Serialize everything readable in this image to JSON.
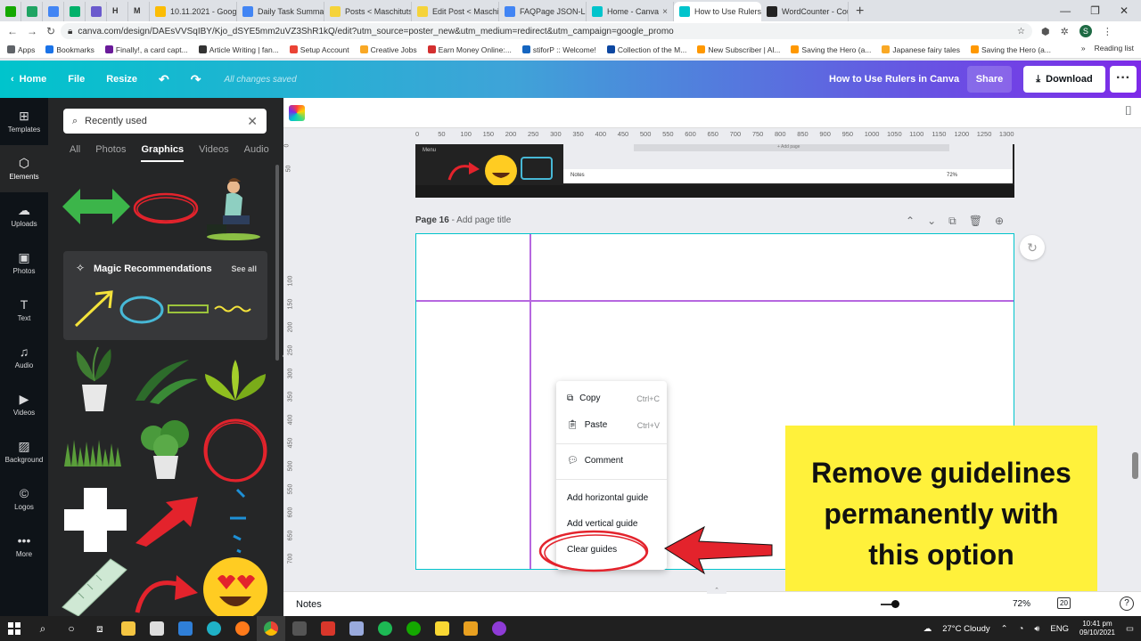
{
  "browser": {
    "tabs": [
      {
        "label": "",
        "color": "#14a800"
      },
      {
        "label": "",
        "color": "#1fa463"
      },
      {
        "label": "",
        "color": "#4285f4"
      },
      {
        "label": "",
        "color": "#00b16a"
      },
      {
        "label": "",
        "color": "#6a5acd"
      },
      {
        "label": "H",
        "color": "#ffffff"
      },
      {
        "label": "M",
        "color": "#ea4335"
      },
      {
        "label": "10.11.2021 - Googl...",
        "color": "#fbbc04"
      },
      {
        "label": "Daily Task Summary",
        "color": "#4285f4"
      },
      {
        "label": "Posts < Maschituts ...",
        "color": "#f5d33a"
      },
      {
        "label": "Edit Post < Maschitu...",
        "color": "#f5d33a"
      },
      {
        "label": "FAQPage JSON-LD S...",
        "color": "#4285f4"
      },
      {
        "label": "Home - Canva",
        "color": "#00c4cc"
      },
      {
        "label": "How to Use Rulers in...",
        "color": "#00c4cc"
      },
      {
        "label": "WordCounter - Cou...",
        "color": "#222222"
      }
    ],
    "active_tab_index": 13,
    "new_tab": "+",
    "url": "canva.com/design/DAEsVVSqIBY/Kjo_dSYE5mm2uVZ3ShR1kQ/edit?utm_source=poster_new&utm_medium=redirect&utm_campaign=google_promo",
    "profile_initial": "S",
    "bookmarks": [
      {
        "label": "Apps",
        "color": "#5f6368"
      },
      {
        "label": "Bookmarks",
        "color": "#1a73e8"
      },
      {
        "label": "Finally!, a card capt...",
        "color": "#6a1b9a"
      },
      {
        "label": "Article Writing | fan...",
        "color": "#333333"
      },
      {
        "label": "Setup Account",
        "color": "#ea4335"
      },
      {
        "label": "Creative Jobs",
        "color": "#f9a825"
      },
      {
        "label": "Earn Money Online:...",
        "color": "#d32f2f"
      },
      {
        "label": "stiforP :: Welcome!",
        "color": "#1565c0"
      },
      {
        "label": "Collection of the M...",
        "color": "#0d47a1"
      },
      {
        "label": "New Subscriber | Al...",
        "color": "#ff9800"
      },
      {
        "label": "Saving the Hero (a...",
        "color": "#ff9800"
      },
      {
        "label": "Japanese fairy tales",
        "color": "#f9a825"
      },
      {
        "label": "Saving the Hero (a...",
        "color": "#ff9800"
      }
    ],
    "bookmarks_overflow": "»",
    "reading_list": "Reading list"
  },
  "canva_header": {
    "home": "Home",
    "file": "File",
    "resize": "Resize",
    "saved_status": "All changes saved",
    "design_title": "How to Use Rulers in Canva",
    "share": "Share",
    "download": "Download"
  },
  "rail": [
    {
      "label": "Templates",
      "icon": "⊞"
    },
    {
      "label": "Elements",
      "icon": "⬡"
    },
    {
      "label": "Uploads",
      "icon": "☁"
    },
    {
      "label": "Photos",
      "icon": "▣"
    },
    {
      "label": "Text",
      "icon": "T"
    },
    {
      "label": "Audio",
      "icon": "♫"
    },
    {
      "label": "Videos",
      "icon": "▶"
    },
    {
      "label": "Background",
      "icon": "▨"
    },
    {
      "label": "Logos",
      "icon": "©"
    },
    {
      "label": "More",
      "icon": "•••"
    }
  ],
  "panel": {
    "search_value": "Recently used",
    "tabs": [
      "All",
      "Photos",
      "Graphics",
      "Videos",
      "Audio"
    ],
    "active_tab": "Graphics",
    "magic_title": "Magic Recommendations",
    "see_all": "See all"
  },
  "editor": {
    "ruler_ticks": [
      "0",
      "50",
      "100",
      "150",
      "200",
      "250",
      "300",
      "350",
      "400",
      "450",
      "500",
      "550",
      "600",
      "650",
      "700",
      "750",
      "800",
      "850",
      "900",
      "950",
      "1000",
      "1050",
      "1100",
      "1150",
      "1200",
      "1250",
      "1300"
    ],
    "vruler_ticks": [
      "0",
      "50",
      "100",
      "150",
      "200",
      "250",
      "300",
      "350",
      "400",
      "450",
      "500",
      "550",
      "600",
      "650",
      "700"
    ],
    "add_page": "+ Add page",
    "page_number": "Page 16",
    "page_title_placeholder": "Add page title",
    "thumb_notes": "Notes",
    "thumb_zoom": "72%",
    "thumb_menu": "Menu"
  },
  "context_menu": {
    "copy": "Copy",
    "copy_shortcut": "Ctrl+C",
    "paste": "Paste",
    "paste_shortcut": "Ctrl+V",
    "comment": "Comment",
    "add_horizontal": "Add horizontal guide",
    "add_vertical": "Add vertical guide",
    "clear_guides": "Clear guides"
  },
  "callout": {
    "text": "Remove guidelines permanently with this option",
    "color": "#fff13b"
  },
  "notes_bar": {
    "label": "Notes",
    "zoom": "72%",
    "page_count": "20",
    "help": "?"
  },
  "taskbar": {
    "weather": "27°C  Cloudy",
    "lang": "ENG",
    "time": "10:41 pm",
    "date": "09/10/2021"
  },
  "colors": {
    "accent": "#00c4cc",
    "purple": "#7d2ae8",
    "annotation_red": "#e3232c"
  }
}
